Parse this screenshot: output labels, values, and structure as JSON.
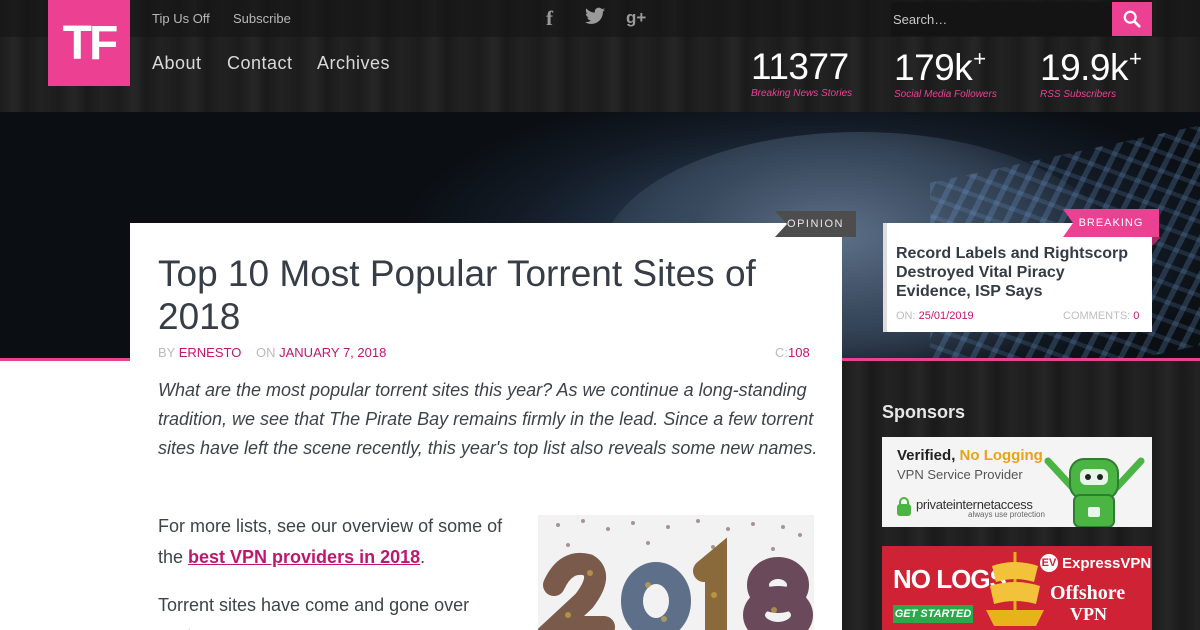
{
  "logo": {
    "text": "TF"
  },
  "topbar": {
    "links": [
      "Tip Us Off",
      "Subscribe"
    ],
    "social_icons": [
      "facebook-icon",
      "twitter-icon",
      "google-plus-icon"
    ],
    "social_glyphs": [
      "f",
      "🐦",
      "g+"
    ],
    "search": {
      "placeholder": "Search…"
    }
  },
  "nav": {
    "items": [
      "About",
      "Contact",
      "Archives"
    ]
  },
  "stats": [
    {
      "value": "11377",
      "plus": "",
      "label": "Breaking News Stories"
    },
    {
      "value": "179k",
      "plus": "+",
      "label": "Social Media Followers"
    },
    {
      "value": "19.9k",
      "plus": "+",
      "label": "RSS Subscribers"
    }
  ],
  "article": {
    "tag": "OPINION",
    "title": "Top 10 Most Popular Torrent Sites of 2018",
    "by_label": "BY",
    "author": "ERNESTO",
    "on_label": "ON",
    "date": "JANUARY 7, 2018",
    "comments_label": "C:",
    "comments": "108",
    "lead": "What are the most popular torrent sites this year? As we continue a long-standing tradition, we see that The Pirate Bay remains firmly in the lead. Since a few torrent sites have left the scene recently, this year's top list also reveals some new names.",
    "para1_before": "For more lists, see our overview of some of the ",
    "para1_link": "best VPN providers in 2018",
    "para1_after": ".",
    "para2": "Torrent sites have come and gone over past"
  },
  "breaking": {
    "tag": "BREAKING",
    "title": "Record Labels and Rightscorp Destroyed Vital Piracy Evidence, ISP Says",
    "on_label": "ON:",
    "date": "25/01/2019",
    "comments_label": "COMMENTS:",
    "comments": "0"
  },
  "sidebar": {
    "sponsors_heading": "Sponsors",
    "ad1": {
      "line1_a": "Verified, ",
      "line1_b": "No Logging",
      "line2": "VPN Service Provider",
      "brand": "privateinternetaccess",
      "tagline": "always use protection"
    },
    "ad2": {
      "left": "NO LOGS",
      "cta": "GET STARTED",
      "brand": "ExpressVPN",
      "right1": "Offshore",
      "right2": "VPN"
    }
  },
  "colors": {
    "accent": "#ec4193",
    "link": "#c0166e",
    "title": "#373d47"
  }
}
